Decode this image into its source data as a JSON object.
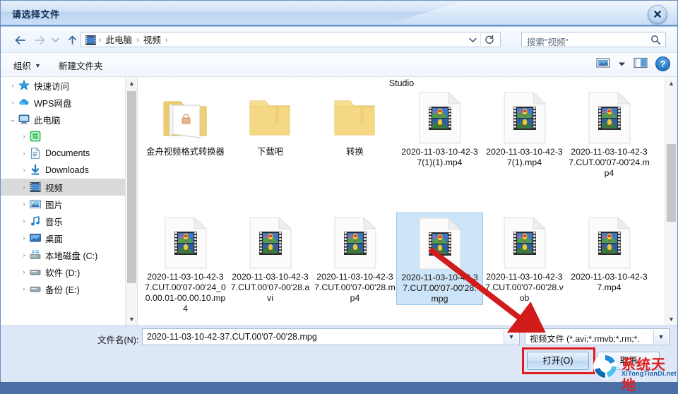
{
  "window": {
    "title": "请选择文件",
    "close_label": "关闭"
  },
  "nav": {
    "back_icon": "back-arrow-icon",
    "forward_icon": "forward-arrow-icon",
    "recent_icon": "chevron-down-icon",
    "up_icon": "up-arrow-icon",
    "address_icon": "videos-folder-icon",
    "breadcrumbs": [
      "此电脑",
      "视频"
    ],
    "separator": "›",
    "refresh_icon": "refresh-icon",
    "dropdown_icon": "chevron-down-icon"
  },
  "search": {
    "placeholder": "搜索\"视频\"",
    "icon": "search-icon"
  },
  "commandbar": {
    "organize": "组织",
    "new_folder": "新建文件夹",
    "view_icon": "view-layout-icon",
    "view_caret_icon": "chevron-down-icon",
    "preview_icon": "preview-pane-icon",
    "help_icon": "help-icon",
    "help_glyph": "?"
  },
  "sidebar": {
    "items": [
      {
        "label": "快速访问",
        "icon": "star-icon",
        "twisty": "›",
        "indent": 0,
        "selected": false
      },
      {
        "label": "WPS网盘",
        "icon": "cloud-icon",
        "twisty": "›",
        "indent": 0,
        "selected": false
      },
      {
        "label": "此电脑",
        "icon": "computer-icon",
        "twisty": "⌄",
        "indent": 0,
        "selected": false
      },
      {
        "label": "",
        "icon": "qt-green-icon",
        "twisty": "›",
        "indent": 1,
        "selected": false
      },
      {
        "label": "Documents",
        "icon": "documents-icon",
        "twisty": "›",
        "indent": 1,
        "selected": false
      },
      {
        "label": "Downloads",
        "icon": "downloads-icon",
        "twisty": "›",
        "indent": 1,
        "selected": false
      },
      {
        "label": "视频",
        "icon": "videos-icon",
        "twisty": "›",
        "indent": 1,
        "selected": true
      },
      {
        "label": "图片",
        "icon": "pictures-icon",
        "twisty": "›",
        "indent": 1,
        "selected": false
      },
      {
        "label": "音乐",
        "icon": "music-icon",
        "twisty": "›",
        "indent": 1,
        "selected": false
      },
      {
        "label": "桌面",
        "icon": "desktop-icon",
        "twisty": "›",
        "indent": 1,
        "selected": false
      },
      {
        "label": "本地磁盘 (C:)",
        "icon": "system-drive-icon",
        "twisty": "›",
        "indent": 1,
        "selected": false
      },
      {
        "label": "软件 (D:)",
        "icon": "drive-icon",
        "twisty": "›",
        "indent": 1,
        "selected": false
      },
      {
        "label": "备份 (E:)",
        "icon": "drive-icon",
        "twisty": "›",
        "indent": 1,
        "selected": false
      }
    ]
  },
  "filepane": {
    "partial_row_label": "Studio",
    "items": [
      {
        "name": "金舟视频格式转换器",
        "type": "folder-open",
        "selected": false
      },
      {
        "name": "下载吧",
        "type": "folder",
        "selected": false
      },
      {
        "name": "转换",
        "type": "folder",
        "selected": false
      },
      {
        "name": "2020-11-03-10-42-37(1)(1).mp4",
        "type": "video",
        "selected": false
      },
      {
        "name": "2020-11-03-10-42-37(1).mp4",
        "type": "video",
        "selected": false
      },
      {
        "name": "2020-11-03-10-42-37.CUT.00'07-00'24.mp4",
        "type": "video",
        "selected": false
      },
      {
        "name": "2020-11-03-10-42-37.CUT.00'07-00'24_00.00.01-00.00.10.mp4",
        "type": "video",
        "selected": false
      },
      {
        "name": "2020-11-03-10-42-37.CUT.00'07-00'28.avi",
        "type": "video",
        "selected": false
      },
      {
        "name": "2020-11-03-10-42-37.CUT.00'07-00'28.mp4",
        "type": "video",
        "selected": false
      },
      {
        "name": "2020-11-03-10-42-37.CUT.00'07-00'28.mpg",
        "type": "video",
        "selected": true
      },
      {
        "name": "2020-11-03-10-42-37.CUT.00'07-00'28.vob",
        "type": "video",
        "selected": false
      },
      {
        "name": "2020-11-03-10-42-37.mp4",
        "type": "video",
        "selected": false
      }
    ]
  },
  "footer": {
    "filename_label": "文件名(N):",
    "filename_value": "2020-11-03-10-42-37.CUT.00'07-00'28.mpg",
    "filetype_value": "视频文件  (*.avi;*.rmvb;*.rm;*.",
    "open_label": "打开(O)",
    "cancel_label": "取消"
  },
  "annotation": {
    "arrow_color": "#d21b1b",
    "highlight_color": "#e01b1b"
  },
  "watermark": {
    "title": "系统天地",
    "subtitle": "XiTongTianDi.net",
    "logo_icon": "recycle-arrows-logo"
  },
  "colors": {
    "selection": "#cce4f7",
    "titlebar": "#cfe1f5",
    "footer": "#dde7f8",
    "accent": "#1565b5"
  }
}
